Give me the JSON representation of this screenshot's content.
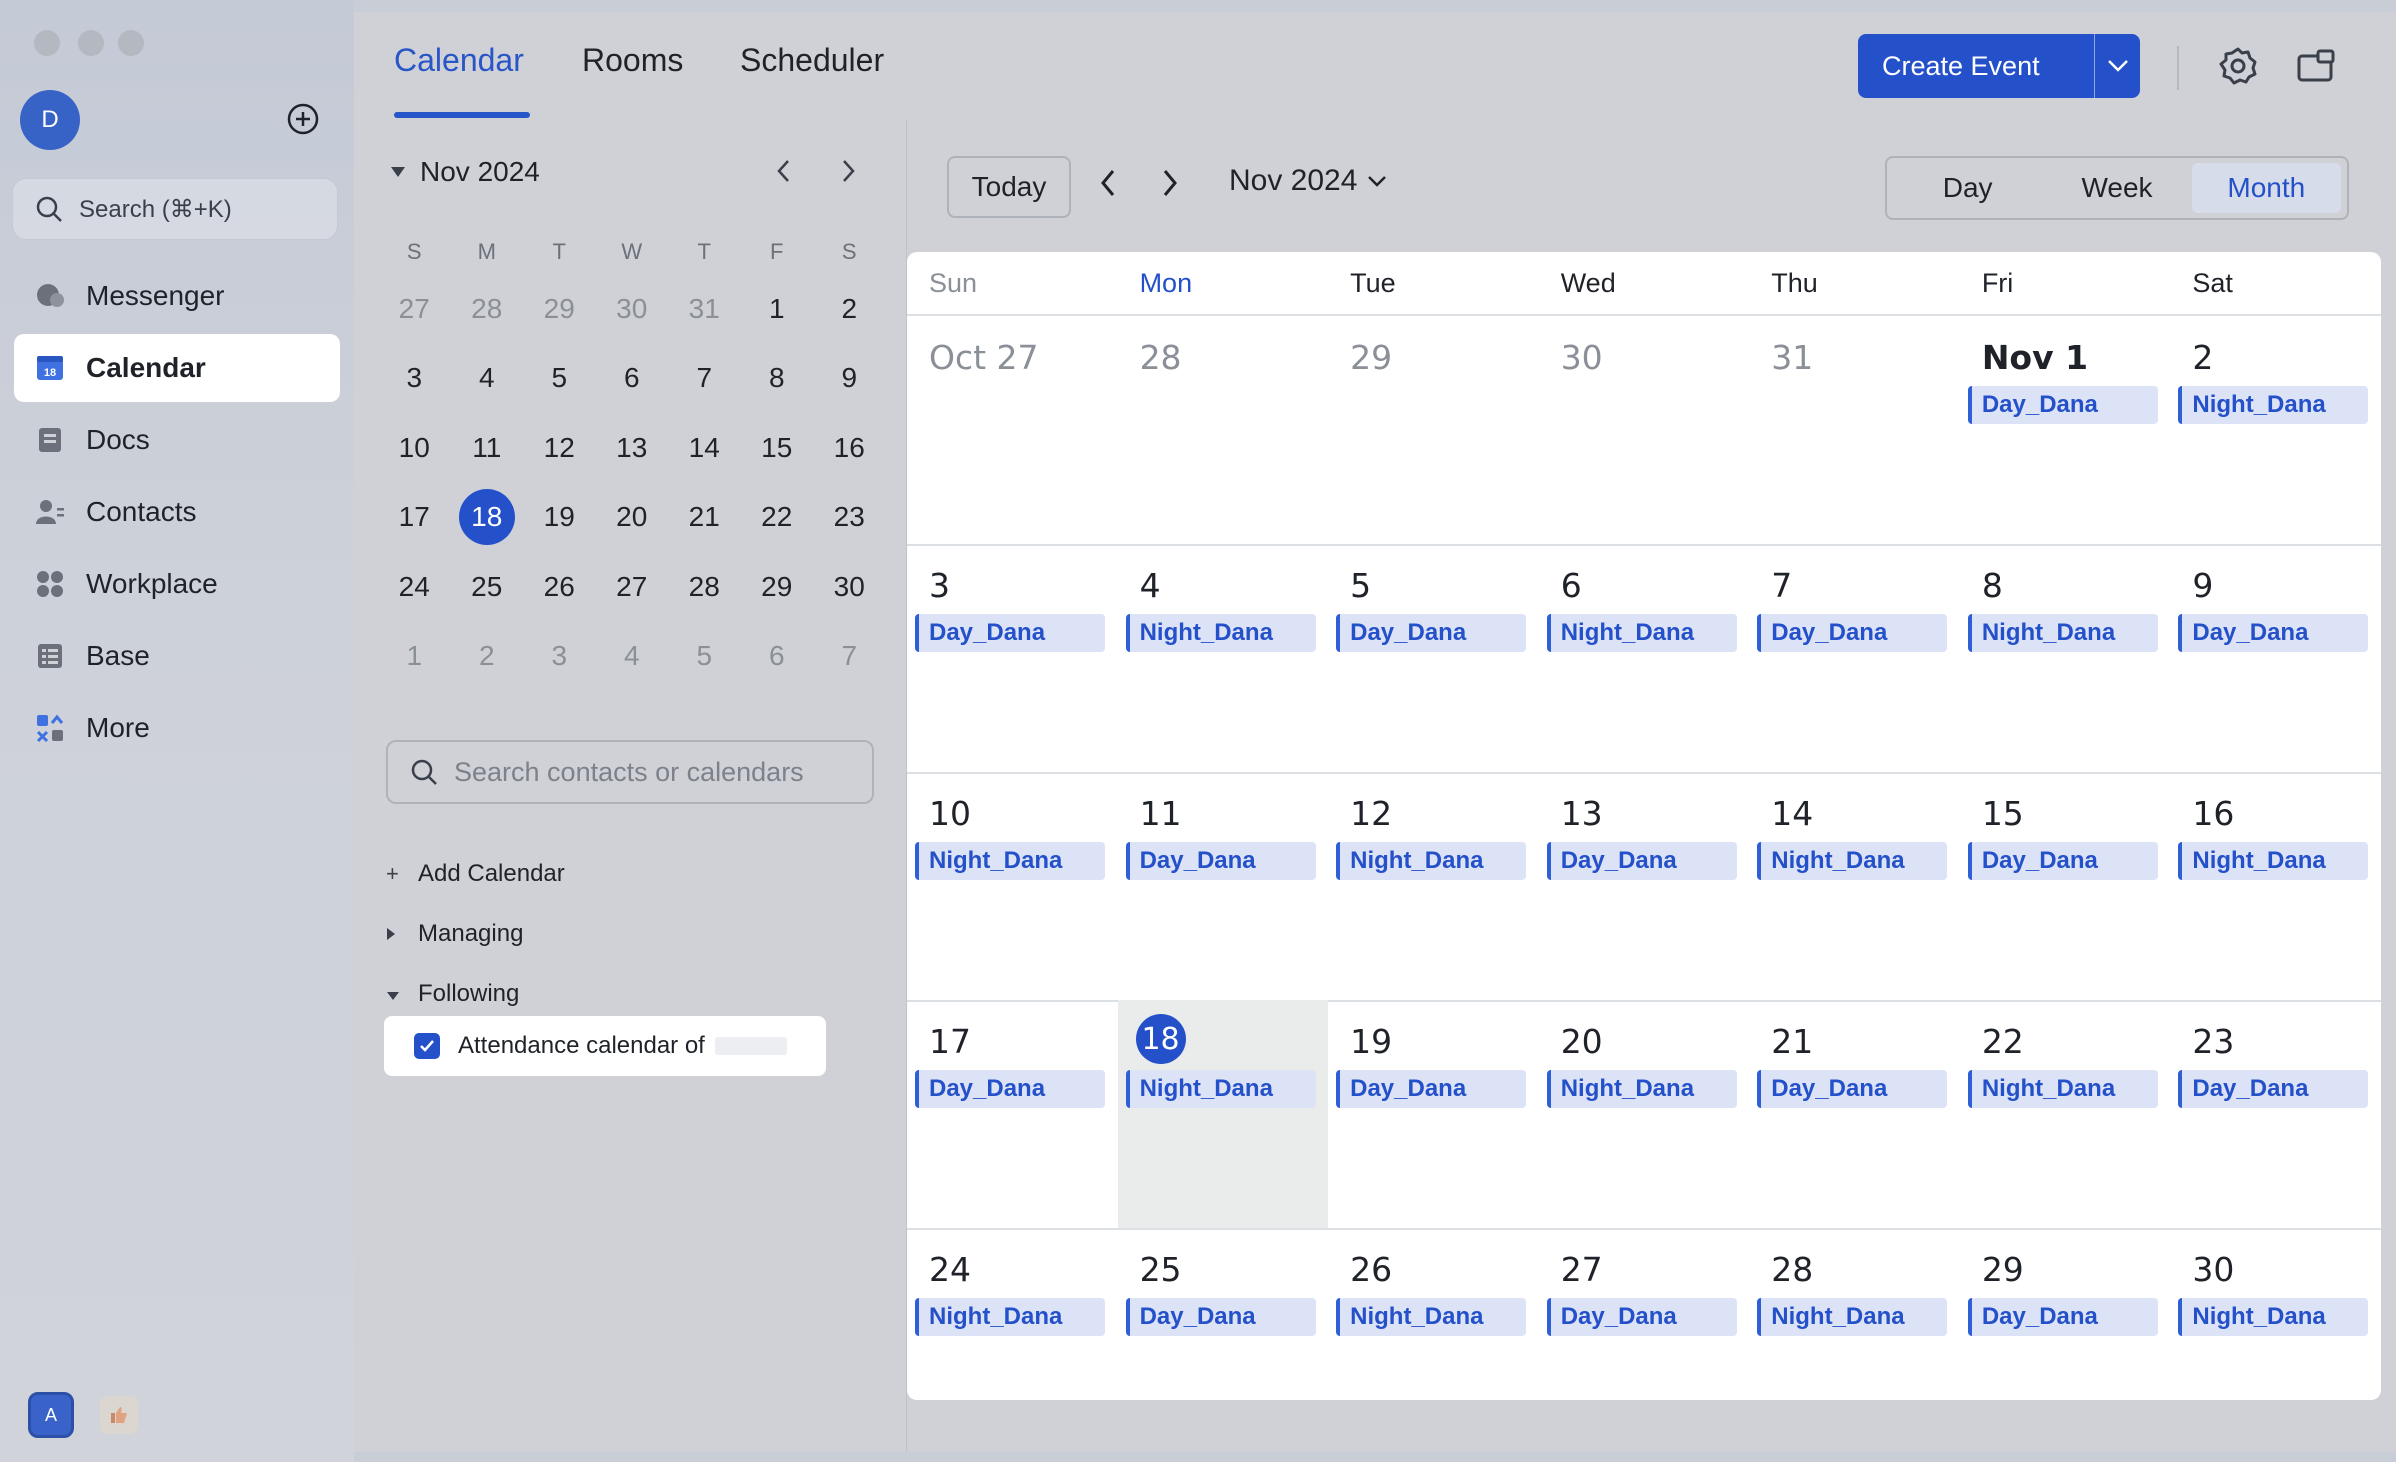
{
  "rail": {
    "avatar_letter": "D",
    "search_label": "Search (⌘+K)",
    "nav": [
      {
        "label": "Messenger",
        "icon": "messenger-icon"
      },
      {
        "label": "Calendar",
        "icon": "calendar-icon",
        "active": true
      },
      {
        "label": "Docs",
        "icon": "docs-icon"
      },
      {
        "label": "Contacts",
        "icon": "contacts-icon"
      },
      {
        "label": "Workplace",
        "icon": "workplace-icon"
      },
      {
        "label": "Base",
        "icon": "base-icon"
      },
      {
        "label": "More",
        "icon": "more-icon"
      }
    ],
    "calendar_icon_day": "18",
    "bottom_avatar_letter": "A"
  },
  "topbar": {
    "tabs": [
      "Calendar",
      "Rooms",
      "Scheduler"
    ],
    "active_tab": "Calendar",
    "create_event_label": "Create Event"
  },
  "mini_calendar": {
    "title": "Nov 2024",
    "weekday_headers": [
      "S",
      "M",
      "T",
      "W",
      "T",
      "F",
      "S"
    ],
    "weeks": [
      [
        "27",
        "28",
        "29",
        "30",
        "31",
        "1",
        "2"
      ],
      [
        "3",
        "4",
        "5",
        "6",
        "7",
        "8",
        "9"
      ],
      [
        "10",
        "11",
        "12",
        "13",
        "14",
        "15",
        "16"
      ],
      [
        "17",
        "18",
        "19",
        "20",
        "21",
        "22",
        "23"
      ],
      [
        "24",
        "25",
        "26",
        "27",
        "28",
        "29",
        "30"
      ],
      [
        "1",
        "2",
        "3",
        "4",
        "5",
        "6",
        "7"
      ]
    ],
    "selected": "18"
  },
  "sidebar": {
    "search_placeholder": "Search contacts or calendars",
    "add_calendar": "Add Calendar",
    "managing": "Managing",
    "following": "Following",
    "following_item": "Attendance calendar of"
  },
  "month_view": {
    "today_label": "Today",
    "title": "Nov 2024",
    "views": [
      "Day",
      "Week",
      "Month"
    ],
    "active_view": "Month",
    "weekdays": [
      "Sun",
      "Mon",
      "Tue",
      "Wed",
      "Thu",
      "Fri",
      "Sat"
    ],
    "weeks": [
      [
        {
          "n": "Oct 27",
          "muted": true
        },
        {
          "n": "28",
          "muted": true
        },
        {
          "n": "29",
          "muted": true
        },
        {
          "n": "30",
          "muted": true
        },
        {
          "n": "31",
          "muted": true
        },
        {
          "n": "Nov 1",
          "bold": true,
          "ev": "Day_Dana"
        },
        {
          "n": "2",
          "ev": "Night_Dana"
        }
      ],
      [
        {
          "n": "3",
          "ev": "Day_Dana"
        },
        {
          "n": "4",
          "ev": "Night_Dana"
        },
        {
          "n": "5",
          "ev": "Day_Dana"
        },
        {
          "n": "6",
          "ev": "Night_Dana"
        },
        {
          "n": "7",
          "ev": "Day_Dana"
        },
        {
          "n": "8",
          "ev": "Night_Dana"
        },
        {
          "n": "9",
          "ev": "Day_Dana"
        }
      ],
      [
        {
          "n": "10",
          "ev": "Night_Dana"
        },
        {
          "n": "11",
          "ev": "Day_Dana"
        },
        {
          "n": "12",
          "ev": "Night_Dana"
        },
        {
          "n": "13",
          "ev": "Day_Dana"
        },
        {
          "n": "14",
          "ev": "Night_Dana"
        },
        {
          "n": "15",
          "ev": "Day_Dana"
        },
        {
          "n": "16",
          "ev": "Night_Dana"
        }
      ],
      [
        {
          "n": "17",
          "ev": "Day_Dana"
        },
        {
          "n": "18",
          "today": true,
          "ev": "Night_Dana"
        },
        {
          "n": "19",
          "ev": "Day_Dana"
        },
        {
          "n": "20",
          "ev": "Night_Dana"
        },
        {
          "n": "21",
          "ev": "Day_Dana"
        },
        {
          "n": "22",
          "ev": "Night_Dana"
        },
        {
          "n": "23",
          "ev": "Day_Dana"
        }
      ],
      [
        {
          "n": "24",
          "ev": "Night_Dana"
        },
        {
          "n": "25",
          "ev": "Day_Dana"
        },
        {
          "n": "26",
          "ev": "Night_Dana"
        },
        {
          "n": "27",
          "ev": "Day_Dana"
        },
        {
          "n": "28",
          "ev": "Night_Dana"
        },
        {
          "n": "29",
          "ev": "Day_Dana"
        },
        {
          "n": "30",
          "ev": "Night_Dana"
        }
      ]
    ]
  },
  "colors": {
    "accent": "#2451c9",
    "event_bg": "#dde3f7"
  }
}
